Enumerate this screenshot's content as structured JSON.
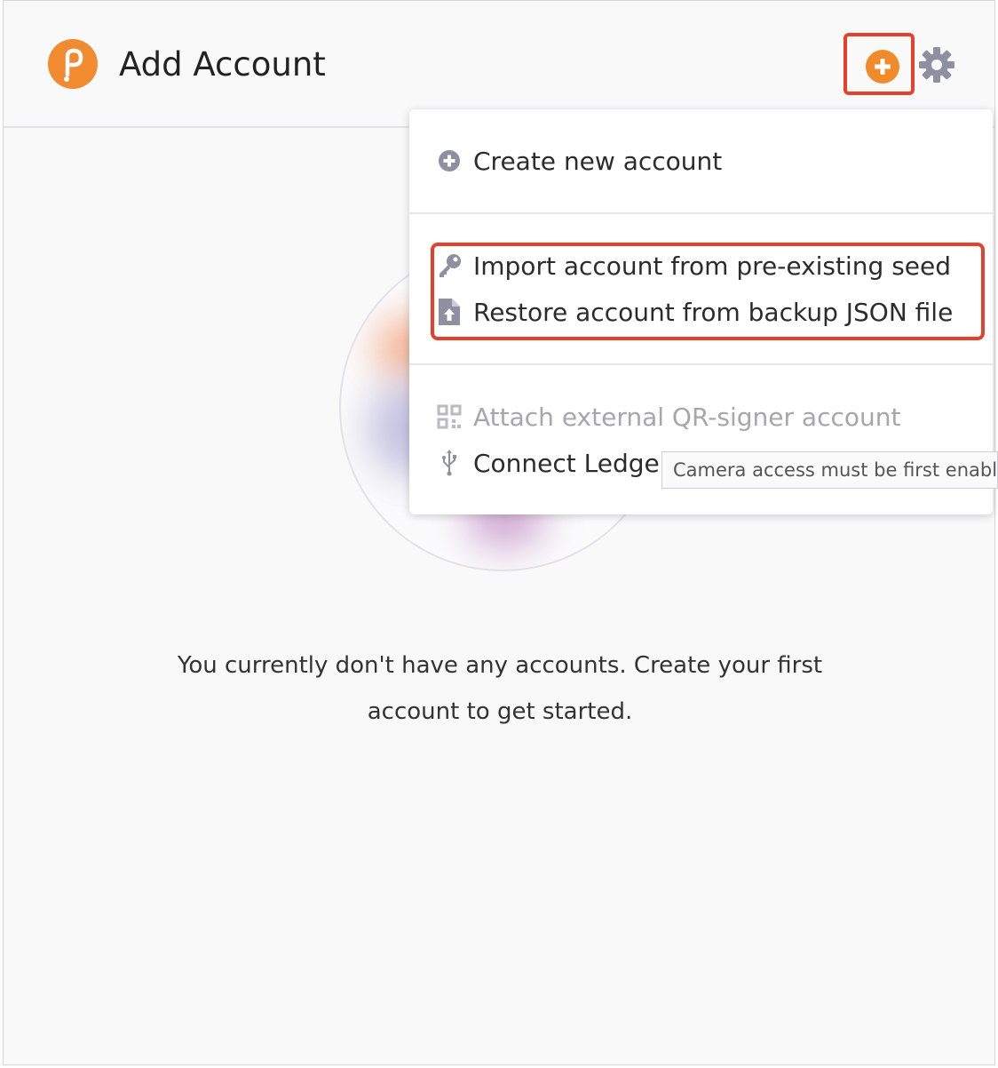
{
  "header": {
    "title": "Add Account",
    "logo_icon": "polkadot-p-logo",
    "add_icon": "plus-circle-icon",
    "settings_icon": "gear-icon"
  },
  "menu": {
    "sections": [
      {
        "items": [
          {
            "label": "Create new account",
            "icon": "plus-circle-icon",
            "disabled": false
          }
        ]
      },
      {
        "items": [
          {
            "label": "Import account from pre-existing seed",
            "icon": "key-icon",
            "disabled": false
          },
          {
            "label": "Restore account from backup JSON file",
            "icon": "file-upload-icon",
            "disabled": false
          }
        ]
      },
      {
        "items": [
          {
            "label": "Attach external QR-signer account",
            "icon": "qrcode-icon",
            "disabled": true
          },
          {
            "label": "Connect Ledger device",
            "icon": "usb-icon",
            "disabled": false
          }
        ]
      }
    ]
  },
  "tooltip": "Camera access must be first enabled",
  "empty_state": {
    "line1": "You currently don't have any accounts. Create your first",
    "line2": "account to get started."
  },
  "colors": {
    "accent": "#f18b30",
    "highlight": "#e5402b",
    "disabled_text": "#a6a6ab"
  }
}
